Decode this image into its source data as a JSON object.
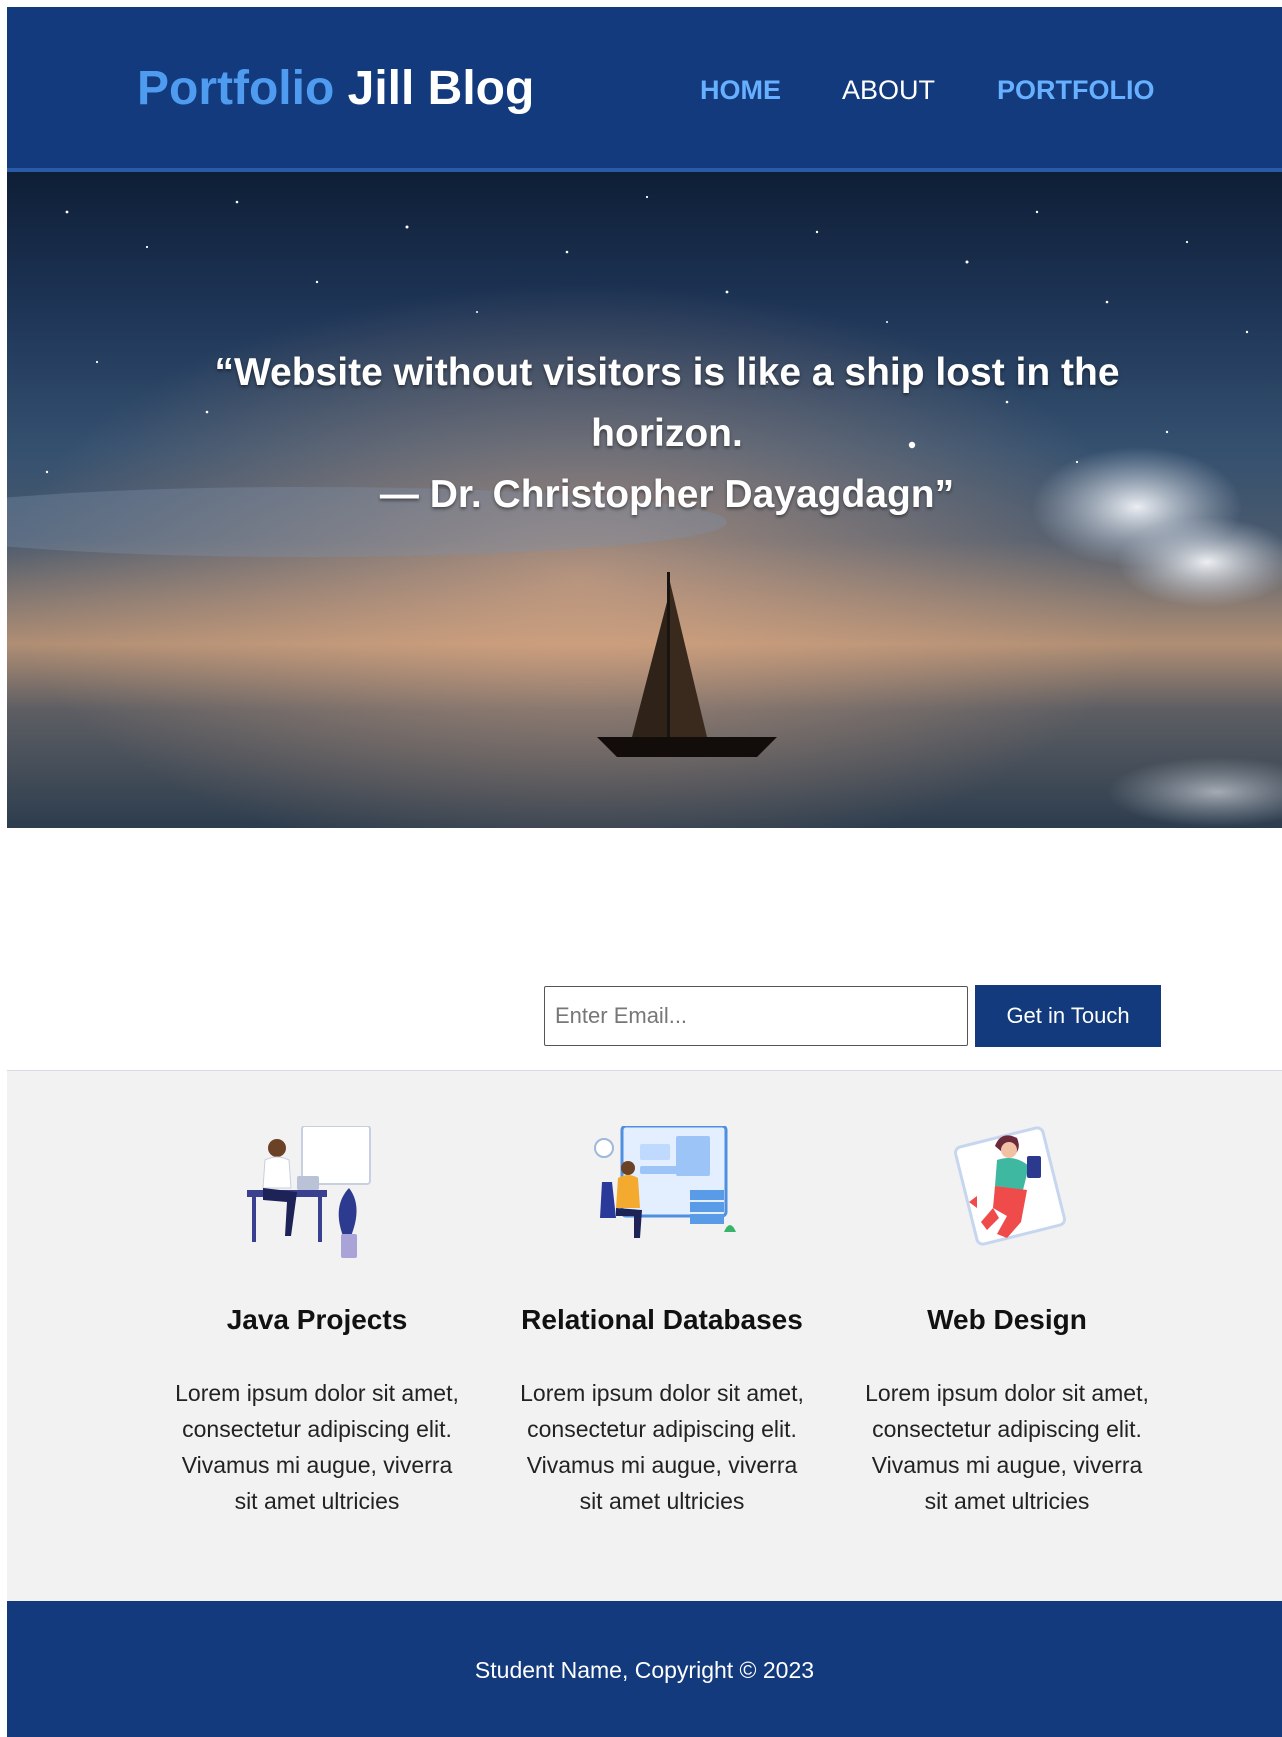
{
  "header": {
    "brand_accent": "Portfolio",
    "brand_main": "Jill Blog",
    "nav": {
      "home": "HOME",
      "about": "ABOUT",
      "portfolio": "PORTFOLIO"
    }
  },
  "hero": {
    "quote_line1": "“Website without visitors is like a ship lost in the",
    "quote_line2": "horizon.",
    "quote_line3": "— Dr. Christopher Dayagdagn”"
  },
  "contact": {
    "email_placeholder": "Enter Email...",
    "button_label": "Get in Touch"
  },
  "services": [
    {
      "title": "Java Projects",
      "icon": "person-at-desk-illustration",
      "desc_lines": [
        "Lorem ipsum dolor sit amet,",
        "consectetur adipiscing elit.",
        "Vivamus mi augue, viverra",
        "sit amet ultricies"
      ]
    },
    {
      "title": "Relational Databases",
      "icon": "person-with-database-illustration",
      "desc_lines": [
        "Lorem ipsum dolor sit amet,",
        "consectetur adipiscing elit.",
        "Vivamus mi augue, viverra",
        "sit amet ultricies"
      ]
    },
    {
      "title": "Web Design",
      "icon": "person-with-phone-illustration",
      "desc_lines": [
        "Lorem ipsum dolor sit amet,",
        "consectetur adipiscing elit.",
        "Vivamus mi augue, viverra",
        "sit amet ultricies"
      ]
    }
  ],
  "footer": {
    "text": "Student Name, Copyright © 2023"
  },
  "colors": {
    "primary": "#123a7d",
    "accent": "#4e9bf0",
    "nav_link": "#66b0ff",
    "section_bg": "#f2f2f2"
  }
}
